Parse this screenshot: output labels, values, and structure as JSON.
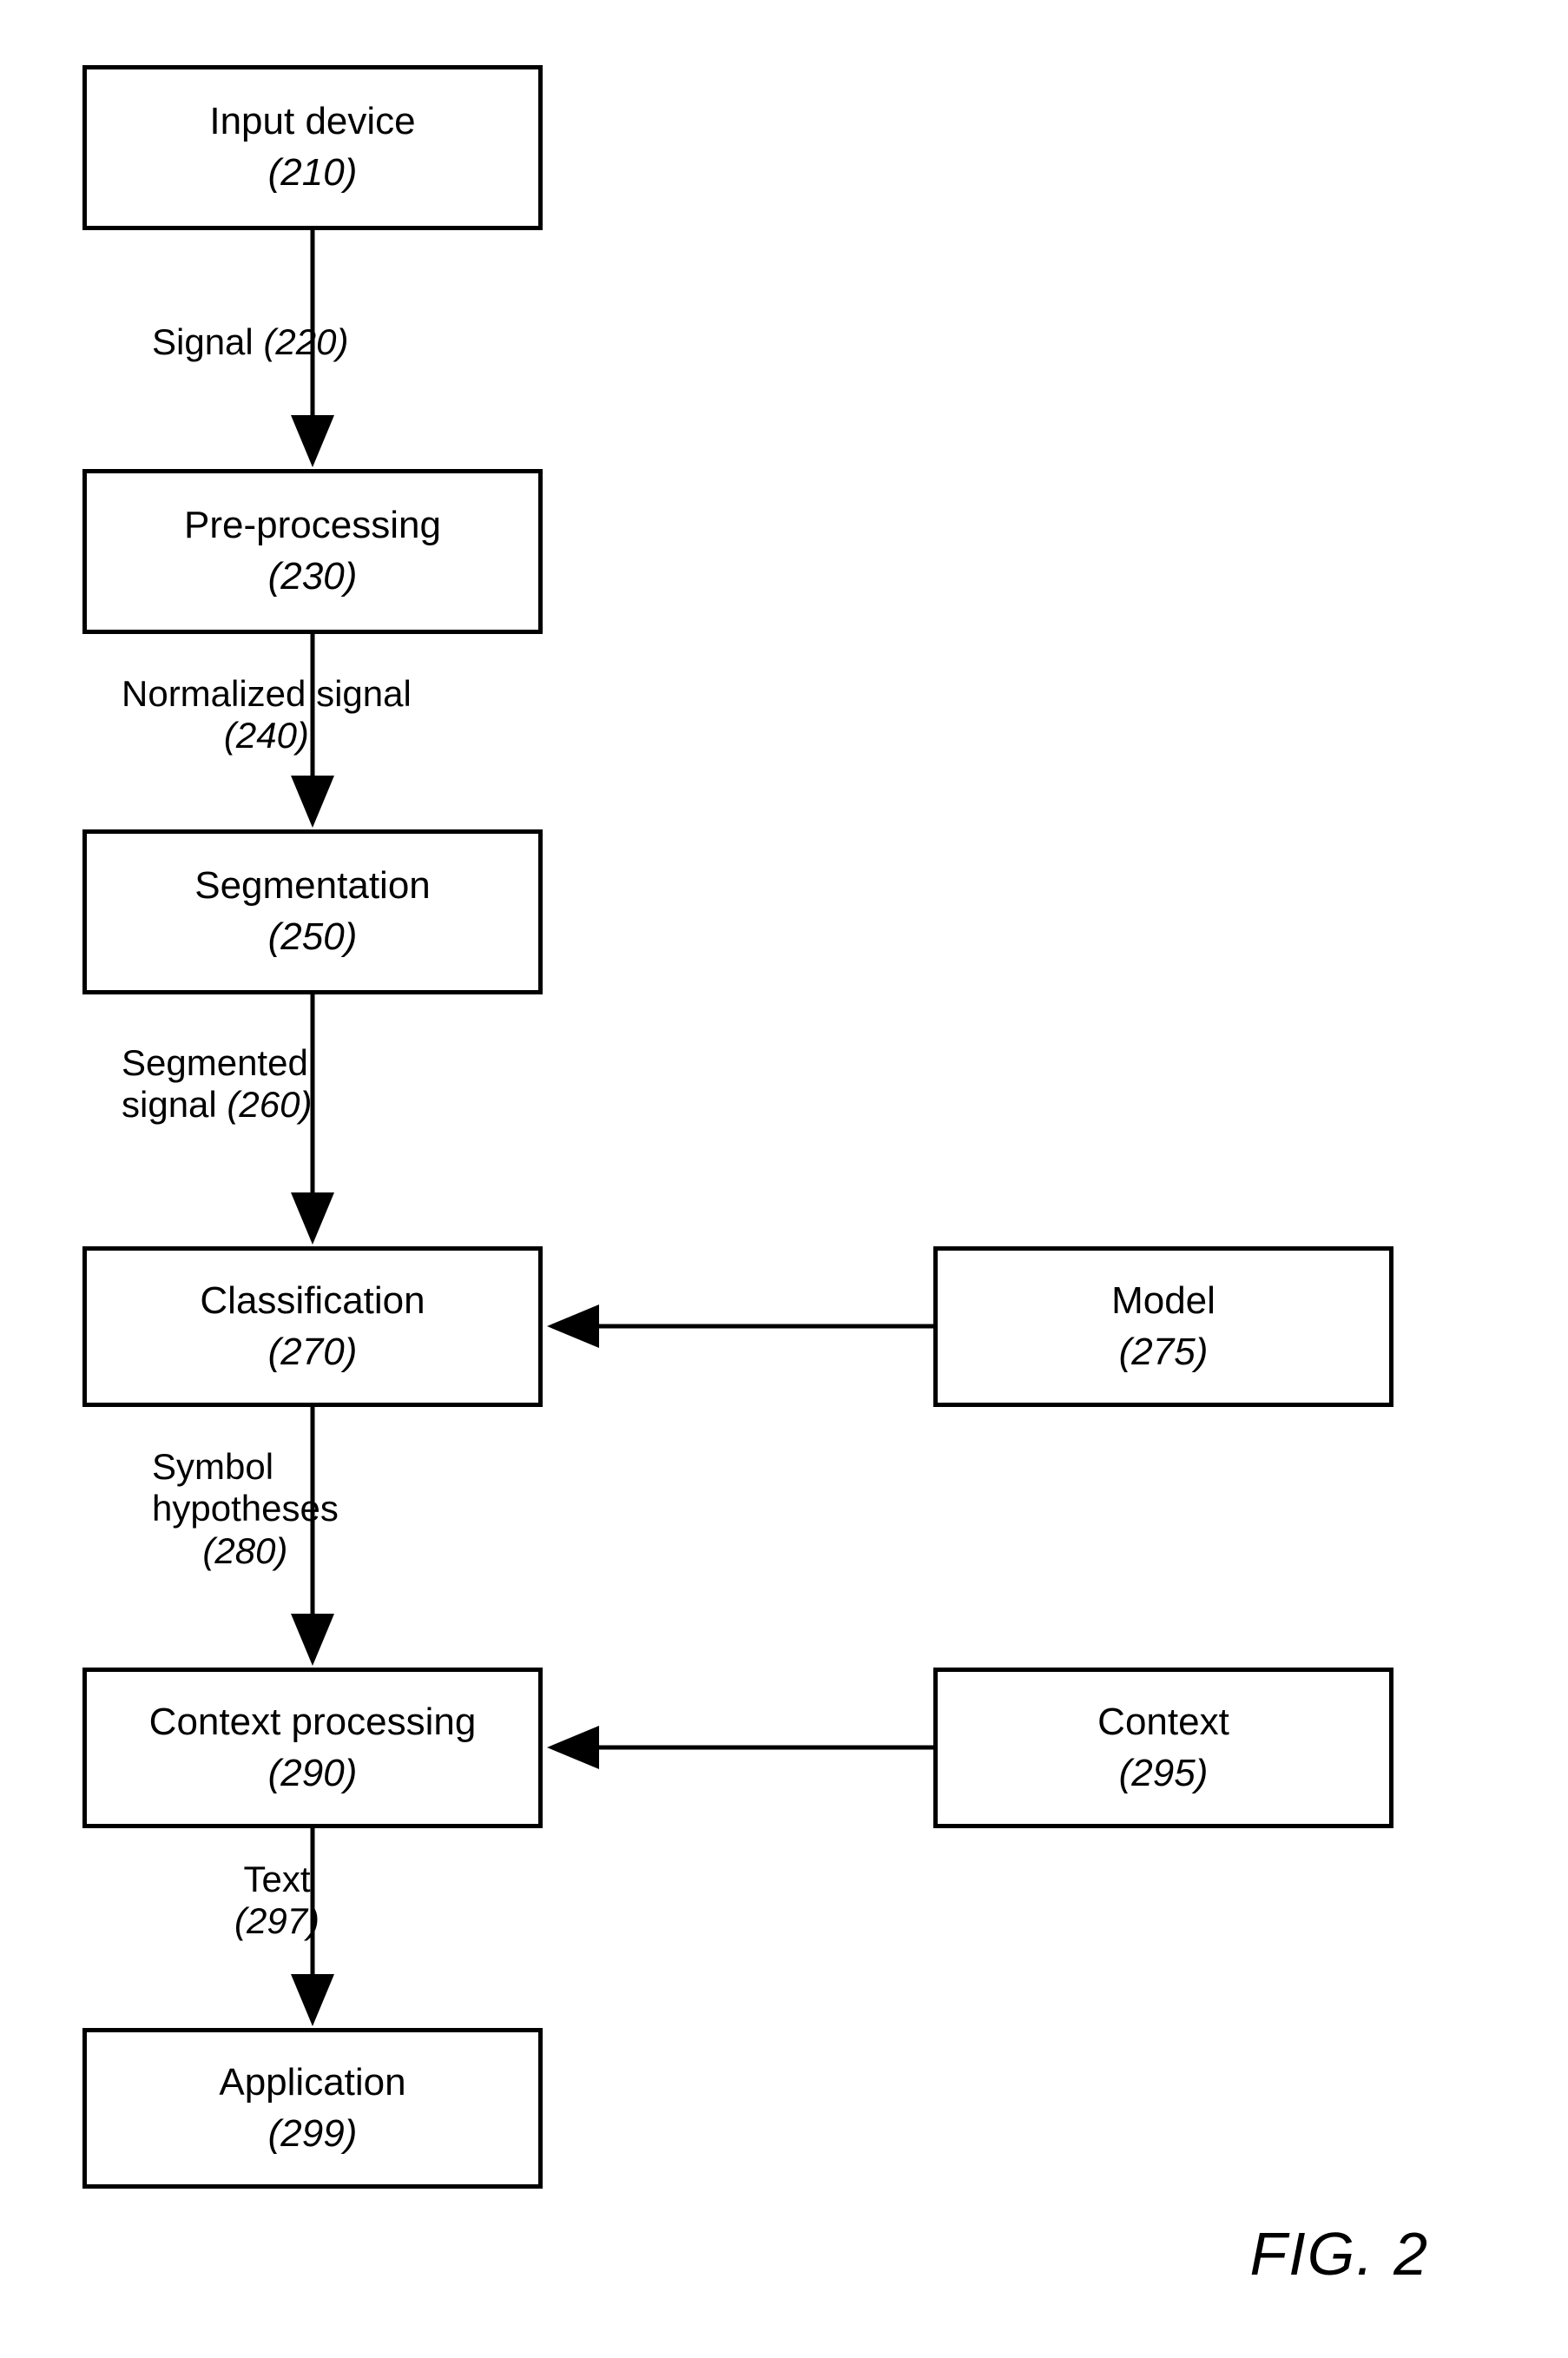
{
  "nodes": {
    "input": {
      "title": "Input device",
      "ref": "(210)"
    },
    "preproc": {
      "title": "Pre-processing",
      "ref": "(230)"
    },
    "segmentation": {
      "title": "Segmentation",
      "ref": "(250)"
    },
    "classification": {
      "title": "Classification",
      "ref": "(270)"
    },
    "model": {
      "title": "Model",
      "ref": "(275)"
    },
    "contextproc": {
      "title": "Context processing",
      "ref": "(290)"
    },
    "context": {
      "title": "Context",
      "ref": "(295)"
    },
    "application": {
      "title": "Application",
      "ref": "(299)"
    }
  },
  "edges": {
    "signal": {
      "line1": "Signal",
      "ref": "(220)"
    },
    "normalized": {
      "line1": "Normalized signal",
      "ref": "(240)"
    },
    "segmented": {
      "line1": "Segmented",
      "line2": "signal",
      "ref": "(260)"
    },
    "symhyp": {
      "line1": "Symbol",
      "line2": "hypotheses",
      "ref": "(280)"
    },
    "text": {
      "line1": "Text",
      "ref": "(297)"
    }
  },
  "figure_label": "FIG. 2"
}
